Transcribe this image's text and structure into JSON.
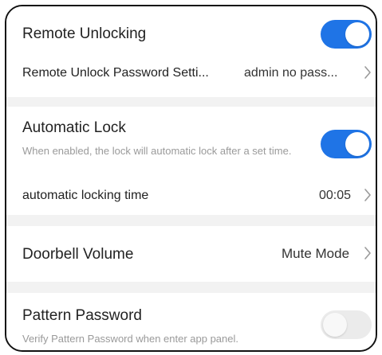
{
  "colors": {
    "accent": "#1f74e6",
    "toggle_off": "#ebebeb",
    "separator": "#f2f2f2"
  },
  "remote_unlocking": {
    "label": "Remote Unlocking",
    "toggle_on": true,
    "password_setting_label": "Remote Unlock Password Setti...",
    "password_setting_value": "admin no pass...",
    "chevron": "chevron-right-icon"
  },
  "automatic_lock": {
    "label": "Automatic Lock",
    "description": "When enabled, the lock will automatic lock after a set time.",
    "toggle_on": true,
    "time_label": "automatic locking time",
    "time_value": "00:05",
    "chevron": "chevron-right-icon"
  },
  "doorbell_volume": {
    "label": "Doorbell Volume",
    "value": "Mute Mode",
    "chevron": "chevron-right-icon"
  },
  "pattern_password": {
    "label": "Pattern Password",
    "description": "Verify Pattern Password when enter app panel.",
    "toggle_on": false
  }
}
